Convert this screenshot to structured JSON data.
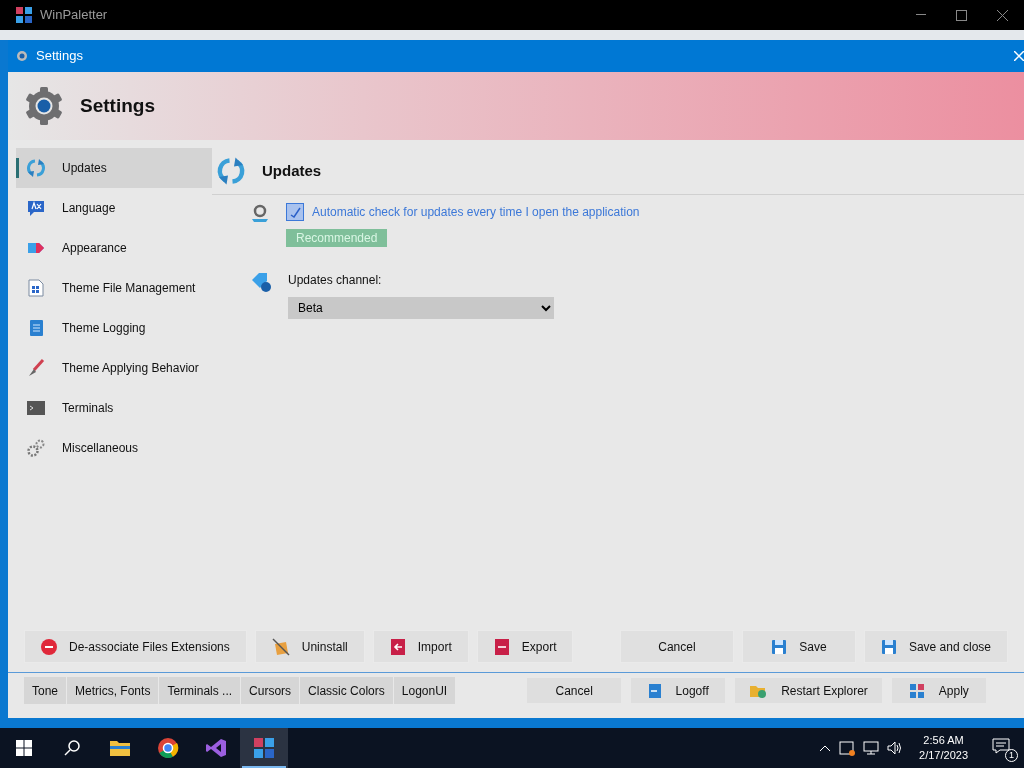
{
  "main_window": {
    "title": "WinPaletter"
  },
  "dialog": {
    "title": "Settings"
  },
  "header": {
    "title": "Settings"
  },
  "sidebar": {
    "items": [
      {
        "label": "Updates",
        "kind": "updates",
        "selected": true
      },
      {
        "label": "Language",
        "kind": "language",
        "selected": false
      },
      {
        "label": "Appearance",
        "kind": "appearance",
        "selected": false
      },
      {
        "label": "Theme File Management",
        "kind": "file",
        "selected": false
      },
      {
        "label": "Theme Logging",
        "kind": "log",
        "selected": false
      },
      {
        "label": "Theme Applying Behavior",
        "kind": "brush",
        "selected": false
      },
      {
        "label": "Terminals",
        "kind": "terminal",
        "selected": false
      },
      {
        "label": "Miscellaneous",
        "kind": "gears",
        "selected": false
      }
    ]
  },
  "section": {
    "title": "Updates"
  },
  "auto_check": {
    "label": "Automatic check for updates every time I open the application",
    "checked": true
  },
  "recommended_badge": "Recommended",
  "channel": {
    "label": "Updates channel:",
    "value": "Beta"
  },
  "left_buttons": [
    {
      "label": "De-associate Files Extensions",
      "kind": "remove"
    },
    {
      "label": "Uninstall",
      "kind": "uninstall"
    },
    {
      "label": "Import",
      "kind": "import"
    },
    {
      "label": "Export",
      "kind": "export"
    }
  ],
  "right_buttons": [
    {
      "label": "Cancel",
      "kind": "plain"
    },
    {
      "label": "Save",
      "kind": "save"
    },
    {
      "label": "Save and close",
      "kind": "save"
    }
  ],
  "background_tabs": [
    "Tone",
    "Metrics, Fonts",
    "Terminals ...",
    "Cursors",
    "Classic Colors",
    "LogonUI"
  ],
  "background_buttons": [
    {
      "label": "Cancel",
      "kind": "plain"
    },
    {
      "label": "Logoff",
      "kind": "logoff"
    },
    {
      "label": "Restart Explorer",
      "kind": "explorer"
    },
    {
      "label": "Apply",
      "kind": "apply"
    }
  ],
  "taskbar": {
    "apps": [
      {
        "kind": "folder",
        "selected": false
      },
      {
        "kind": "browser",
        "selected": false
      },
      {
        "kind": "studio",
        "selected": false
      },
      {
        "kind": "palette",
        "selected": true
      }
    ]
  },
  "clock": {
    "time": "2:56 AM",
    "date": "2/17/2023"
  },
  "notifications": {
    "count": "1"
  }
}
